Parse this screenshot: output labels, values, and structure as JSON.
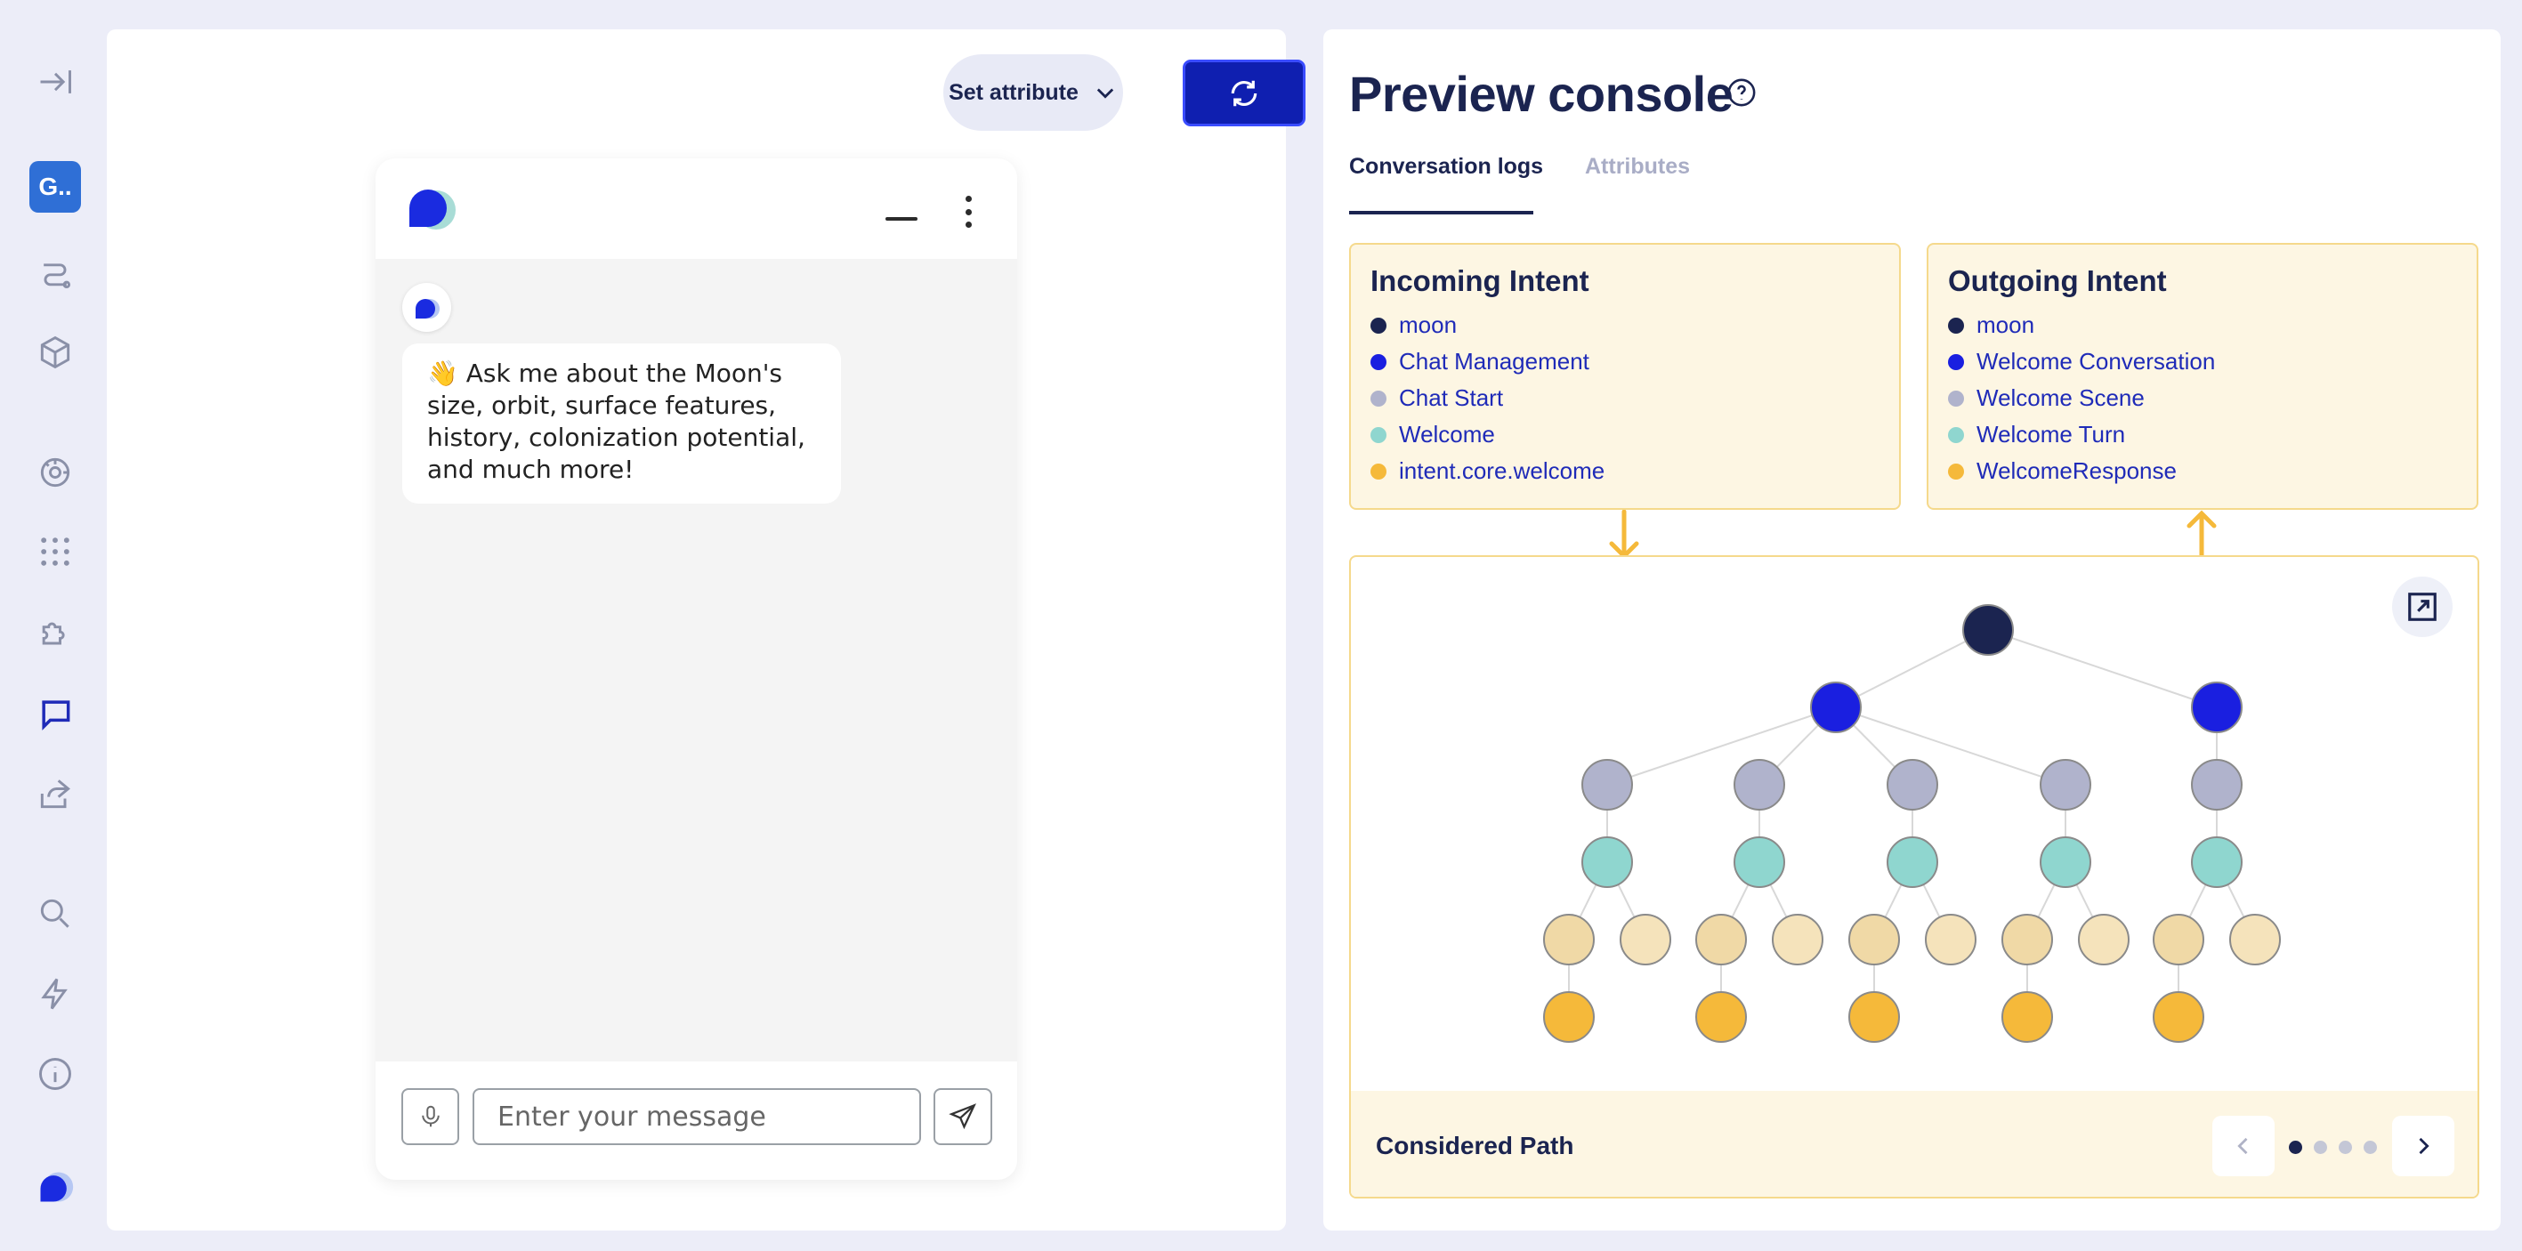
{
  "sidebar": {
    "workspace_badge": "G..",
    "icons": [
      "collapse-icon",
      "flows-icon",
      "cube-icon",
      "brain-icon",
      "dots-grid-icon",
      "puzzle-icon",
      "chat-icon",
      "share-icon",
      "search-icon",
      "lightning-icon",
      "info-icon",
      "logo-icon"
    ],
    "active_icon": "chat-icon"
  },
  "toolbar": {
    "set_attribute_label": "Set attribute",
    "refresh_icon": "refresh-icon"
  },
  "chat": {
    "bot_message": "👋 Ask me about the Moon's size, orbit, surface features, history, colonization potential, and much more!",
    "input_placeholder": "Enter your message"
  },
  "console": {
    "title": "Preview console",
    "tabs": [
      {
        "label": "Conversation logs",
        "active": true
      },
      {
        "label": "Attributes",
        "active": false
      }
    ],
    "incoming": {
      "title": "Incoming Intent",
      "items": [
        {
          "label": "moon",
          "color": "#1b2450"
        },
        {
          "label": "Chat Management",
          "color": "#1a1fe0"
        },
        {
          "label": "Chat Start",
          "color": "#b0b3cc"
        },
        {
          "label": "Welcome",
          "color": "#8fd6cf"
        },
        {
          "label": "intent.core.welcome",
          "color": "#f5b93a"
        }
      ]
    },
    "outgoing": {
      "title": "Outgoing Intent",
      "items": [
        {
          "label": "moon",
          "color": "#1b2450"
        },
        {
          "label": "Welcome Conversation",
          "color": "#1a1fe0"
        },
        {
          "label": "Welcome Scene",
          "color": "#b0b3cc"
        },
        {
          "label": "Welcome Turn",
          "color": "#8fd6cf"
        },
        {
          "label": "WelcomeResponse",
          "color": "#f5b93a"
        }
      ]
    },
    "considered_path_label": "Considered Path",
    "pager": {
      "total": 4,
      "current": 1
    }
  }
}
